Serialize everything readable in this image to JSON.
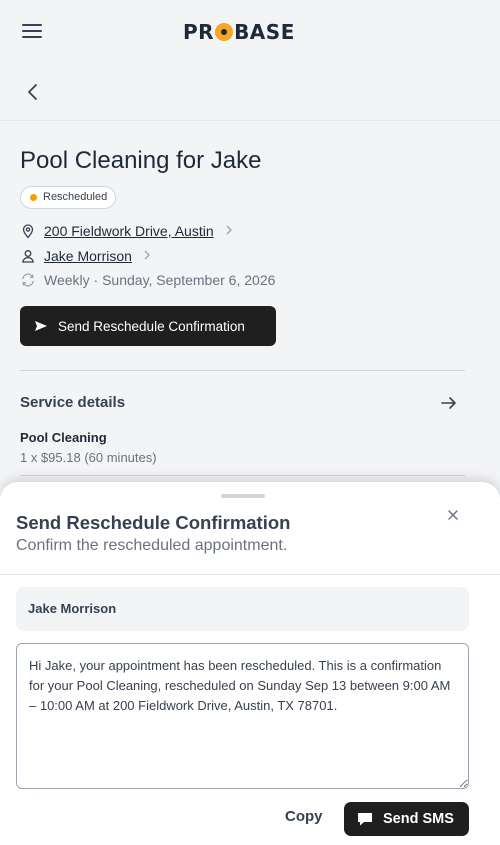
{
  "header": {
    "logo_left": "PR",
    "logo_right": "BASE"
  },
  "job": {
    "title": "Pool Cleaning for Jake",
    "status": "Rescheduled",
    "address": "200 Fieldwork Drive, Austin",
    "customer": "Jake Morrison",
    "schedule": "Weekly · Sunday, September 6, 2026",
    "send_button": "Send Reschedule Confirmation"
  },
  "service": {
    "header": "Service details",
    "name": "Pool Cleaning",
    "price_line": "1 x $95.18 (60 minutes)"
  },
  "sheet": {
    "title": "Send Reschedule Confirmation",
    "subtitle": "Confirm the rescheduled appointment.",
    "recipient": "Jake Morrison",
    "message": "Hi Jake, your appointment has been rescheduled. This is a confirmation for your Pool Cleaning, rescheduled on Sunday Sep 13 between 9:00 AM – 10:00 AM at 200 Fieldwork Drive, Austin, TX 78701.",
    "copy_label": "Copy",
    "sms_label": "Send SMS"
  },
  "colors": {
    "accent": "#f5a623",
    "status_dot": "#f59e0b",
    "dark_button": "#1f1f1f"
  }
}
